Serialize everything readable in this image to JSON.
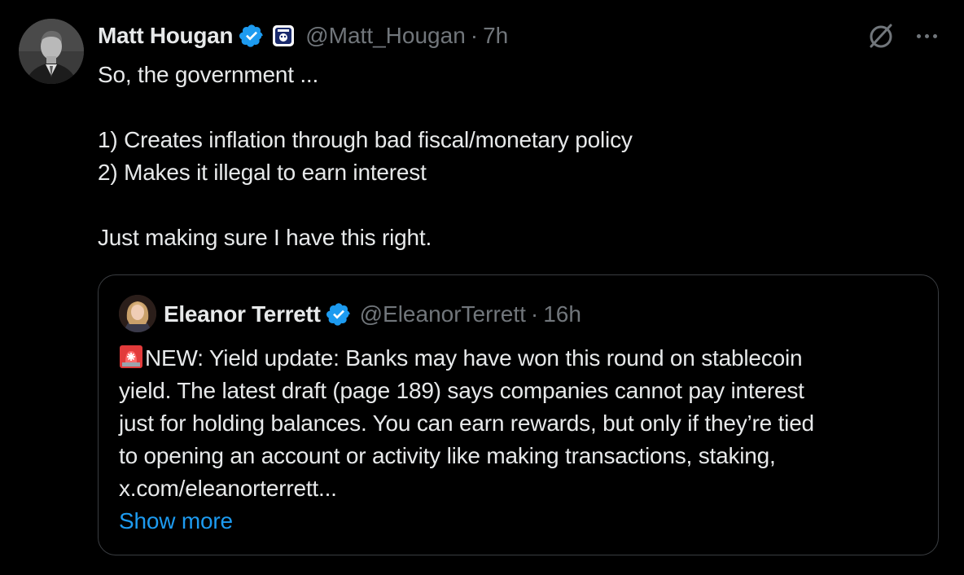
{
  "tweet": {
    "author_name": "Matt Hougan",
    "handle": "@Matt_Hougan",
    "separator": "·",
    "time": "7h",
    "lines": [
      "So, the government ...",
      "",
      "1) Creates inflation through bad fiscal/monetary policy",
      "2) Makes it illegal to earn interest",
      "",
      "Just making sure I have this right."
    ],
    "icons": {
      "verified": "verified-badge-icon",
      "affiliate": "affiliate-badge-icon",
      "grok": "grok-icon",
      "more": "more-icon"
    }
  },
  "quote": {
    "author_name": "Eleanor Terrett",
    "handle": "@EleanorTerrett",
    "separator": "·",
    "time": "16h",
    "lines": [
      "NEW: Yield update: Banks may have won this round on stablecoin",
      "yield. The latest draft (page 189) says companies cannot pay interest",
      "just for holding balances. You can earn rewards, but only if they’re tied",
      "to opening an account or activity like making transactions, staking,",
      "x.com/eleanorterrett..."
    ],
    "show_more": "Show more",
    "icons": {
      "siren": "rotating-light-icon",
      "verified": "verified-badge-icon"
    }
  },
  "colors": {
    "background": "#000000",
    "text": "#e7e9ea",
    "secondary": "#71767b",
    "accent": "#1d9bf0",
    "border": "#3a3d41"
  }
}
